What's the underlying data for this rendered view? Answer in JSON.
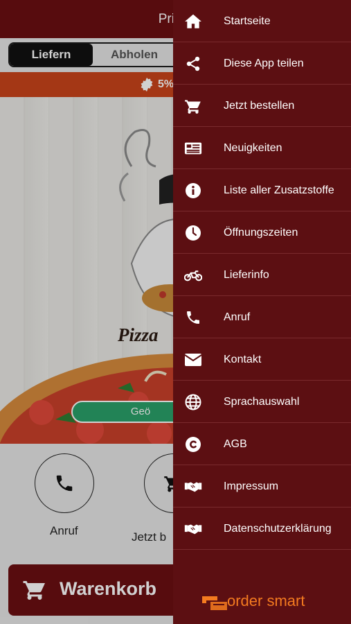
{
  "app": {
    "title": "Prima",
    "toggle": {
      "deliver": "Liefern",
      "pickup": "Abholen"
    },
    "promo_text": "5%",
    "brand_text": "Pizza",
    "status_text": "Geö",
    "actions": [
      {
        "label": "Anruf",
        "icon": "phone-icon"
      },
      {
        "label": "Jetzt b",
        "icon": "cart-icon"
      }
    ],
    "cart_label": "Warenkorb"
  },
  "drawer": {
    "items": [
      {
        "label": "Startseite",
        "icon": "home-icon"
      },
      {
        "label": "Diese App teilen",
        "icon": "share-icon"
      },
      {
        "label": "Jetzt bestellen",
        "icon": "cart-icon"
      },
      {
        "label": "Neuigkeiten",
        "icon": "news-icon"
      },
      {
        "label": "Liste aller Zusatzstoffe",
        "icon": "info-icon"
      },
      {
        "label": "Öffnungszeiten",
        "icon": "clock-icon"
      },
      {
        "label": "Lieferinfo",
        "icon": "motorbike-icon"
      },
      {
        "label": "Anruf",
        "icon": "phone-icon"
      },
      {
        "label": "Kontakt",
        "icon": "mail-icon"
      },
      {
        "label": "Sprachauswahl",
        "icon": "globe-icon"
      },
      {
        "label": "AGB",
        "icon": "copyright-icon"
      },
      {
        "label": "Impressum",
        "icon": "handshake-icon"
      },
      {
        "label": "Datenschutzerklärung",
        "icon": "handshake-icon"
      }
    ],
    "footer_brand": "order smart"
  },
  "colors": {
    "primary": "#6b0f12",
    "drawer": "#5c0f12",
    "promo": "#c9441a",
    "open_status": "#2aa06a",
    "brand_orange": "#f47b20"
  }
}
